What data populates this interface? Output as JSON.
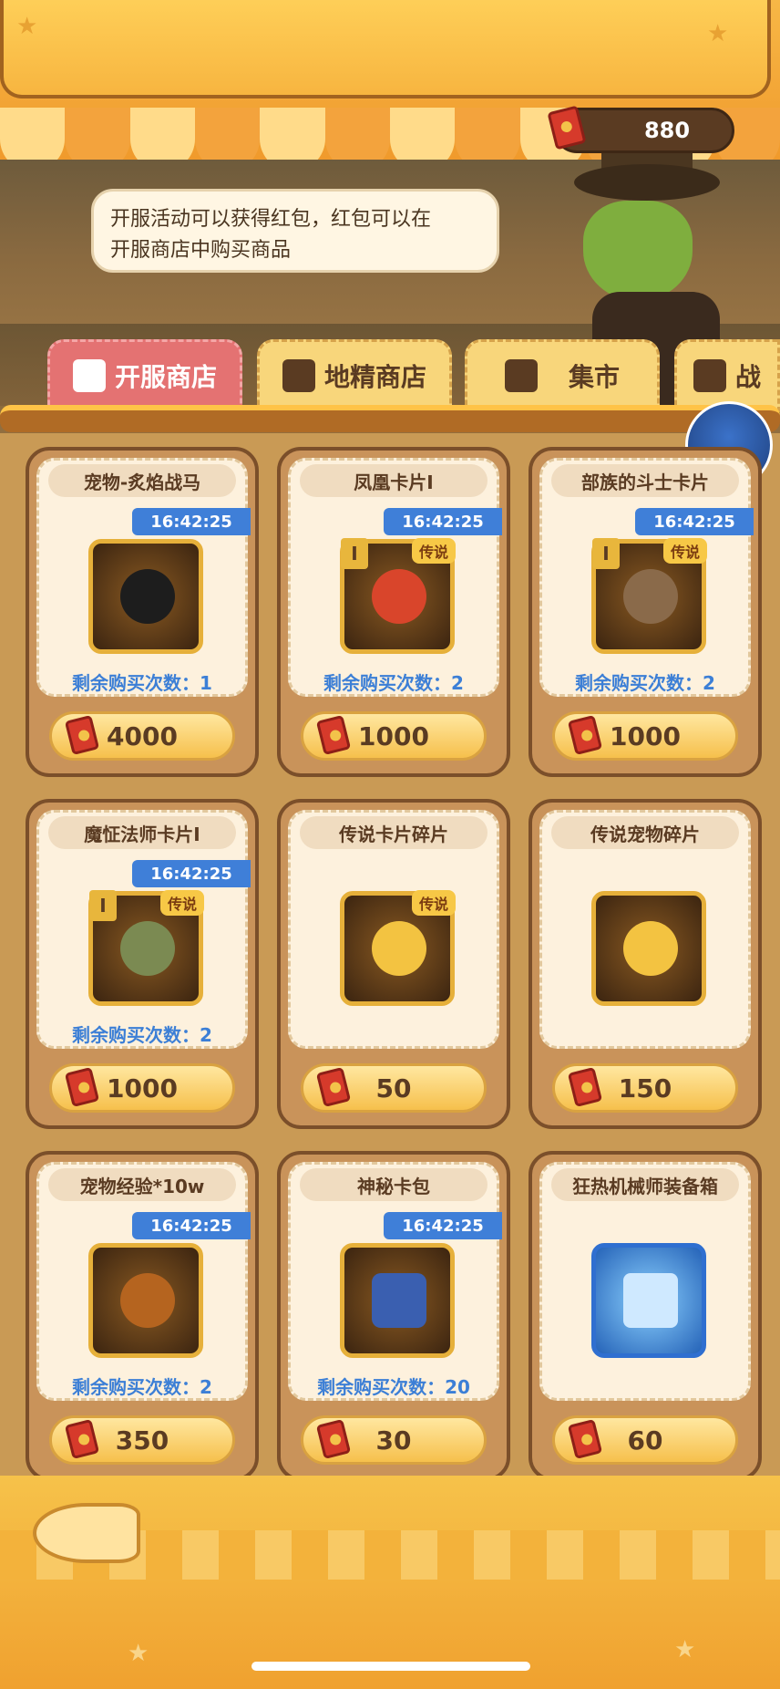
{
  "header": {
    "currency_amount": "880",
    "speech_line1": "开服活动可以获得红包，红包可以在",
    "speech_line2": "开服商店中购买商品"
  },
  "tabs": [
    {
      "label": "开服商店",
      "active": true
    },
    {
      "label": "地精商店",
      "active": false
    },
    {
      "label": "集市",
      "active": false
    },
    {
      "label": "战",
      "active": false
    }
  ],
  "items": [
    {
      "title": "宠物-炙焰战马",
      "timer": "16:42:25",
      "remaining_label": "剩余购买次数：1",
      "price": "4000",
      "badge": "",
      "rank": ""
    },
    {
      "title": "凤凰卡片Ⅰ",
      "timer": "16:42:25",
      "remaining_label": "剩余购买次数：2",
      "price": "1000",
      "badge": "传说",
      "rank": "I"
    },
    {
      "title": "部族的斗士卡片",
      "timer": "16:42:25",
      "remaining_label": "剩余购买次数：2",
      "price": "1000",
      "badge": "传说",
      "rank": "I"
    },
    {
      "title": "魔怔法师卡片Ⅰ",
      "timer": "16:42:25",
      "remaining_label": "剩余购买次数：2",
      "price": "1000",
      "badge": "传说",
      "rank": "I"
    },
    {
      "title": "传说卡片碎片",
      "timer": "",
      "remaining_label": "",
      "price": "50",
      "badge": "传说",
      "rank": ""
    },
    {
      "title": "传说宠物碎片",
      "timer": "",
      "remaining_label": "",
      "price": "150",
      "badge": "",
      "rank": ""
    },
    {
      "title": "宠物经验*10w",
      "timer": "16:42:25",
      "remaining_label": "剩余购买次数：2",
      "price": "350",
      "badge": "",
      "rank": ""
    },
    {
      "title": "神秘卡包",
      "timer": "16:42:25",
      "remaining_label": "剩余购买次数：20",
      "price": "30",
      "badge": "",
      "rank": ""
    },
    {
      "title": "狂热机械师装备箱",
      "timer": "",
      "remaining_label": "",
      "price": "60",
      "badge": "",
      "rank": ""
    }
  ],
  "colors": {
    "accent_orange": "#f7b746",
    "active_tab": "#e47272",
    "timer_blue": "#3f7fd8",
    "price_gold": "#f6c04c"
  },
  "icons": [
    "red-packet-icon",
    "shop-icon",
    "goblin-shop-icon",
    "market-icon",
    "battle-icon",
    "fishbone-icon"
  ]
}
